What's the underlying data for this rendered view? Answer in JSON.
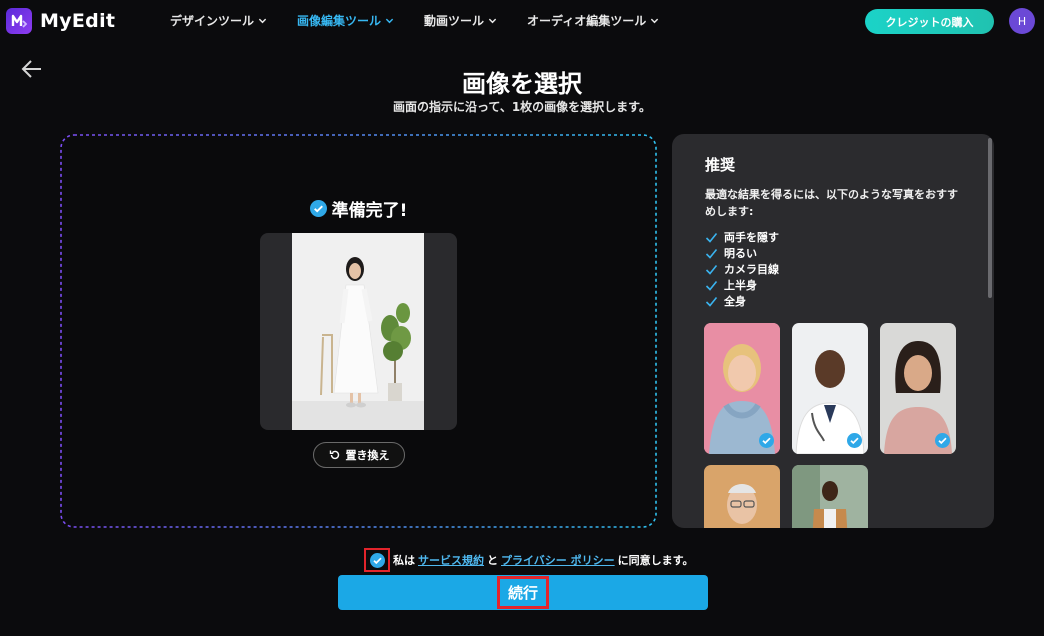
{
  "header": {
    "brand": "MyEdit",
    "nav": [
      {
        "label": "デザインツール",
        "active": false
      },
      {
        "label": "画像編集ツール",
        "active": true
      },
      {
        "label": "動画ツール",
        "active": false
      },
      {
        "label": "オーディオ編集ツール",
        "active": false
      }
    ],
    "buy_credits": "クレジットの購入",
    "avatar_initial": "H"
  },
  "page": {
    "title": "画像を選択",
    "subtitle": "画面の指示に沿って、1枚の画像を選択します。"
  },
  "upload": {
    "status": "準備完了!",
    "replace_label": "置き換え"
  },
  "recommend": {
    "title": "推奨",
    "description": "最適な結果を得るには、以下のような写真をおすすめします:",
    "items": [
      "両手を隠す",
      "明るい",
      "カメラ目線",
      "上半身",
      "全身"
    ]
  },
  "agreement": {
    "prefix": "私は",
    "terms_link": "サービス規約",
    "conjunction": "と",
    "privacy_link": "プライバシー ポリシー",
    "suffix": "に同意します。"
  },
  "continue_label": "続行",
  "colors": {
    "accent": "#37b7f1",
    "continue_bg": "#1ba8e6",
    "highlight_border": "#e3242b",
    "buy_button": "#1bd3c8"
  }
}
